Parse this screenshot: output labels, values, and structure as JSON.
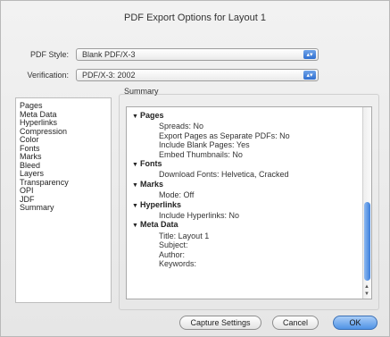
{
  "window": {
    "title": "PDF Export Options for Layout 1"
  },
  "pdf_style": {
    "label": "PDF Style:",
    "value": "Blank PDF/X-3"
  },
  "verification": {
    "label": "Verification:",
    "value": "PDF/X-3: 2002"
  },
  "categories": [
    "Pages",
    "Meta Data",
    "Hyperlinks",
    "Compression",
    "Color",
    "Fonts",
    "Marks",
    "Bleed",
    "Layers",
    "Transparency",
    "OPI",
    "JDF",
    "Summary"
  ],
  "summary": {
    "label": "Summary",
    "sections": [
      {
        "title": "Pages",
        "items": [
          "Spreads: No",
          "Export Pages as Separate PDFs: No",
          "Include Blank Pages: Yes",
          "Embed Thumbnails: No"
        ]
      },
      {
        "title": "Fonts",
        "items": [
          "Download Fonts: Helvetica, Cracked"
        ]
      },
      {
        "title": "Marks",
        "items": [
          "Mode: Off"
        ]
      },
      {
        "title": "Hyperlinks",
        "items": [
          "Include Hyperlinks: No"
        ]
      },
      {
        "title": "Meta Data",
        "items": [
          "Title: Layout 1",
          "Subject:",
          "Author:",
          "Keywords:"
        ]
      }
    ]
  },
  "buttons": {
    "capture": "Capture Settings",
    "cancel": "Cancel",
    "ok": "OK"
  },
  "colors": {
    "accent": "#4f93e6"
  },
  "icons": {
    "popup_arrows": "up-down-arrows-icon",
    "disclosure": "disclosure-triangle-icon"
  }
}
